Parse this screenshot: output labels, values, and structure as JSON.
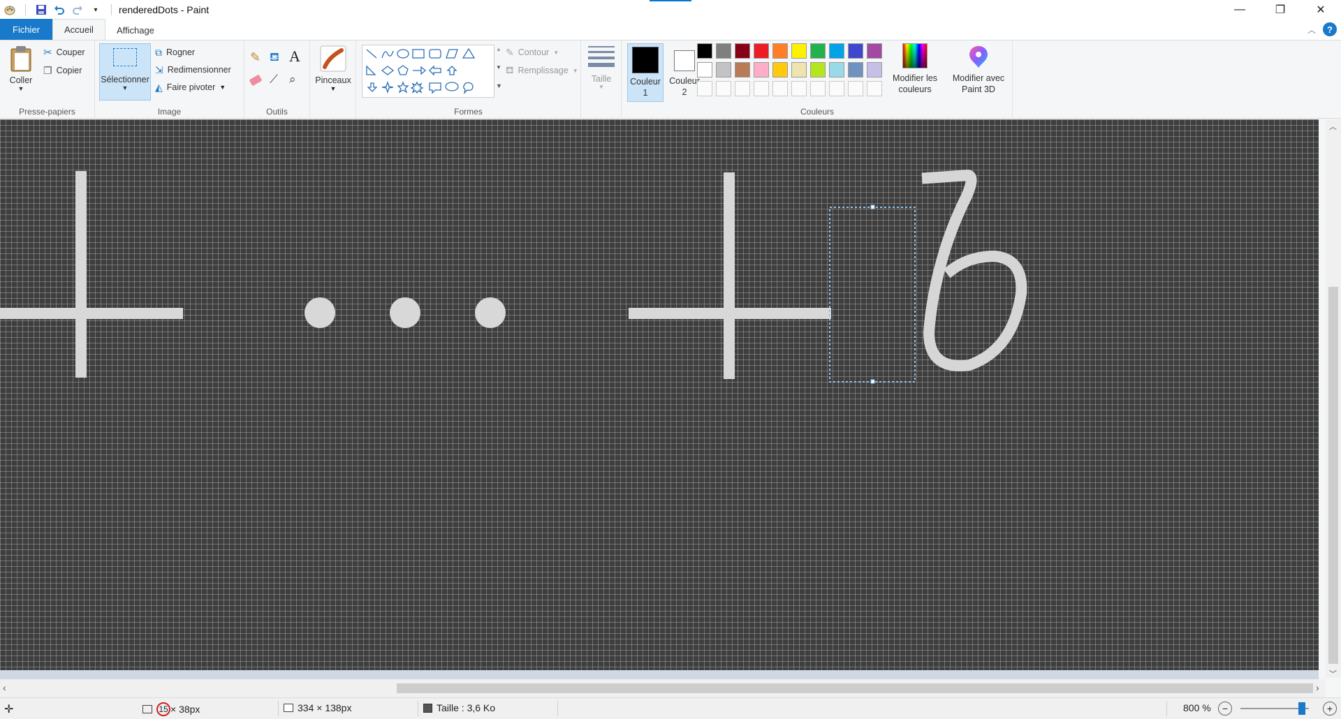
{
  "window": {
    "title": "renderedDots - Paint",
    "controls": {
      "minimize": "—",
      "maximize": "❐",
      "close": "✕"
    }
  },
  "tabs": [
    "Fichier",
    "Accueil",
    "Affichage"
  ],
  "ribbon": {
    "clipboard": {
      "label": "Presse-papiers",
      "paste": "Coller",
      "cut": "Couper",
      "copy": "Copier"
    },
    "image": {
      "label": "Image",
      "select": "Sélectionner",
      "crop": "Rogner",
      "resize": "Redimensionner",
      "rotate": "Faire pivoter"
    },
    "tools": {
      "label": "Outils"
    },
    "brushes": {
      "label": "Pinceaux"
    },
    "shapes": {
      "label": "Formes",
      "outline": "Contour",
      "fill": "Remplissage"
    },
    "size": {
      "label": "Taille"
    },
    "colors": {
      "label": "Couleurs",
      "color1": "Couleur 1",
      "color2": "Couleur 2",
      "color1_value": "#000000",
      "color2_value": "#ffffff",
      "edit_colors": "Modifier les couleurs",
      "paint3d": "Modifier avec Paint 3D",
      "palette": [
        "#000000",
        "#7f7f7f",
        "#880015",
        "#ed1c24",
        "#ff7f27",
        "#fff200",
        "#22b14c",
        "#00a2e8",
        "#3f48cc",
        "#a349a4",
        "#ffffff",
        "#c3c3c3",
        "#b97a57",
        "#ffaec9",
        "#ffc90e",
        "#efe4b0",
        "#b5e61d",
        "#99d9ea",
        "#7092be",
        "#c8bfe7"
      ]
    }
  },
  "status": {
    "cursor_size_prefix": "15",
    "cursor_size": " × 38px",
    "image_size": "334 × 138px",
    "file_size": "Taille : 3,6 Ko",
    "zoom": "800 %",
    "zoom_level_fraction": 0.9
  }
}
